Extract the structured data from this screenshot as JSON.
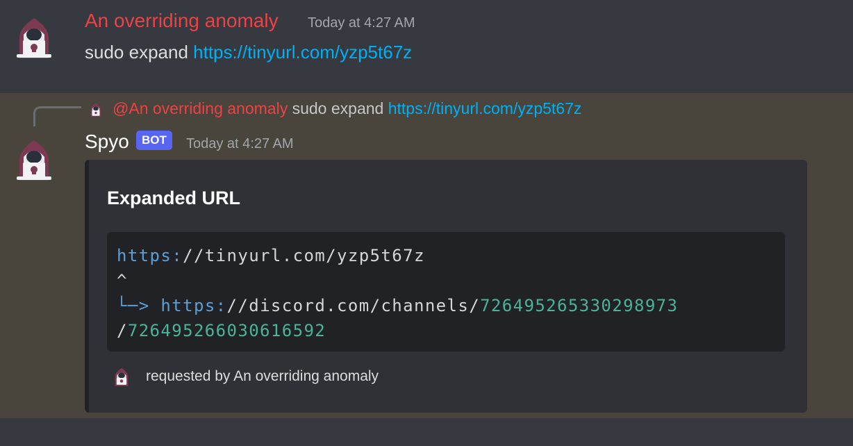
{
  "messages": [
    {
      "author": "An overriding anomaly",
      "timestamp": "Today at 4:27 AM",
      "command": "sudo expand",
      "link": "https://tinyurl.com/yzp5t67z"
    },
    {
      "reply": {
        "mention": "@An overriding anomaly",
        "command": "sudo expand",
        "link": "https://tinyurl.com/yzp5t67z"
      },
      "author": "Spyo",
      "bot_tag": "BOT",
      "timestamp": "Today at 4:27 AM",
      "embed": {
        "title": "Expanded URL",
        "code": {
          "line1_scheme": "https:",
          "line1_rest": "//tinyurl.com/yzp5t67z",
          "line2": "^",
          "line3_arrow": "└─>",
          "line3_scheme": "https:",
          "line3_rest": "//discord.com/channels/",
          "line3_id": "726495265330298973",
          "line4_slash": "/",
          "line4_id": "726495266030616592"
        },
        "footer": "requested by An overriding anomaly"
      }
    }
  ],
  "colors": {
    "author_red": "#ed4245",
    "link_blue": "#00b0f4",
    "bot_tag": "#5865f2",
    "reply_bg": "#49443c"
  },
  "icons": {
    "avatar": "hacker-avatar-icon"
  }
}
